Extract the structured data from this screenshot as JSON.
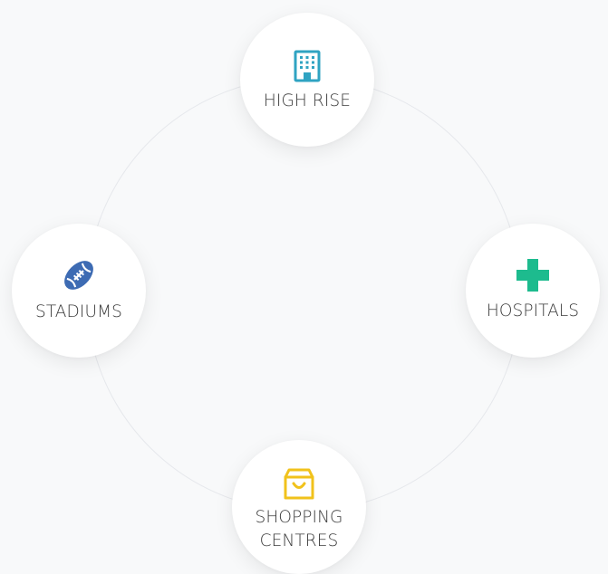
{
  "diagram": {
    "nodes": [
      {
        "id": "high-rise",
        "label": "HIGH RISE",
        "icon": "building-icon",
        "color": "#2fa3c2"
      },
      {
        "id": "stadiums",
        "label": "STADIUMS",
        "icon": "football-icon",
        "color": "#3d6bb3"
      },
      {
        "id": "hospitals",
        "label": "HOSPITALS",
        "icon": "medical-cross-icon",
        "color": "#1dbb8e"
      },
      {
        "id": "shopping",
        "label": "SHOPPING\nCENTRES",
        "icon": "shopping-bag-icon",
        "color": "#f1c21b"
      }
    ]
  }
}
